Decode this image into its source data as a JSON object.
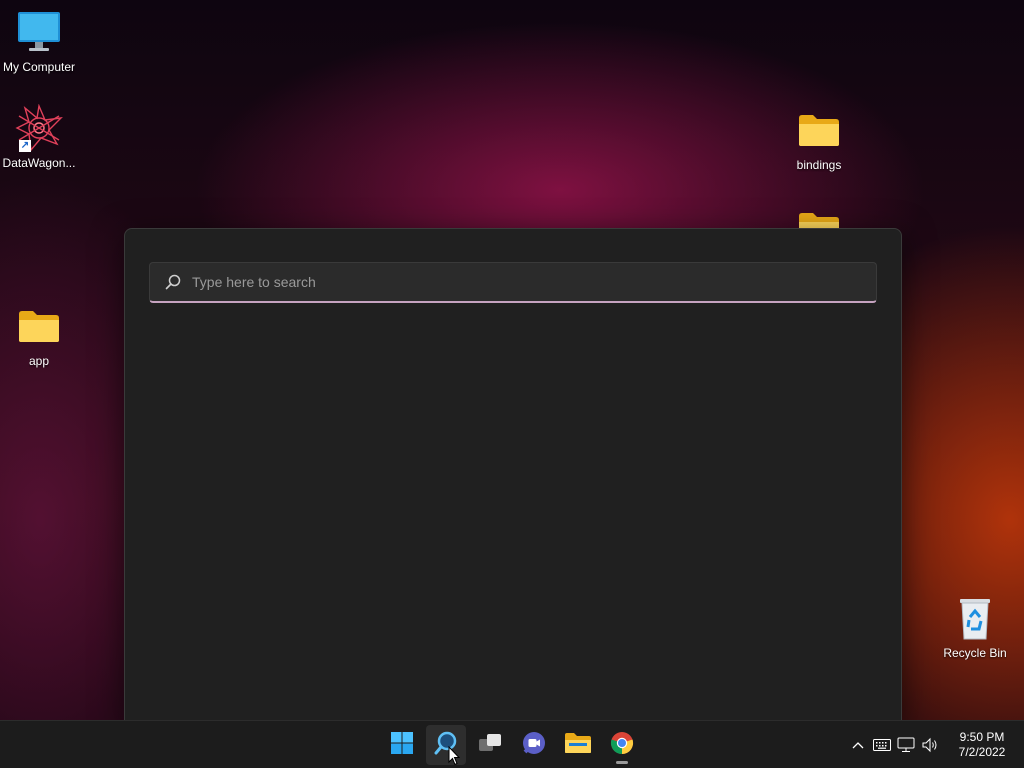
{
  "desktop": {
    "icons": [
      {
        "label": "My Computer",
        "icon": "monitor-icon"
      },
      {
        "label": "DataWagon...",
        "icon": "datawagon-app-icon"
      },
      {
        "label": "app",
        "icon": "folder-icon"
      },
      {
        "label": "bindings",
        "icon": "folder-icon"
      },
      {
        "label": "",
        "icon": "folder-icon"
      },
      {
        "label": "Recycle Bin",
        "icon": "recycle-bin-icon"
      }
    ]
  },
  "search": {
    "placeholder": "Type here to search",
    "value": ""
  },
  "taskbar": {
    "apps": [
      {
        "name": "Start",
        "icon": "windows-start-icon"
      },
      {
        "name": "Search",
        "icon": "search-icon",
        "active": true
      },
      {
        "name": "Task View",
        "icon": "task-view-icon"
      },
      {
        "name": "Chat",
        "icon": "chat-icon"
      },
      {
        "name": "File Explorer",
        "icon": "file-explorer-icon"
      },
      {
        "name": "Google Chrome",
        "icon": "chrome-icon",
        "running": true
      }
    ],
    "tray": {
      "icons": [
        "chevron-up-icon",
        "keyboard-icon",
        "network-icon",
        "volume-icon"
      ]
    },
    "clock": {
      "time": "9:50 PM",
      "date": "7/2/2022"
    }
  },
  "colors": {
    "panel_bg": "#202020",
    "search_accent": "#c6a3c0",
    "taskbar_bg": "#1c1c1c",
    "folder_yellow": "#f5c518"
  }
}
